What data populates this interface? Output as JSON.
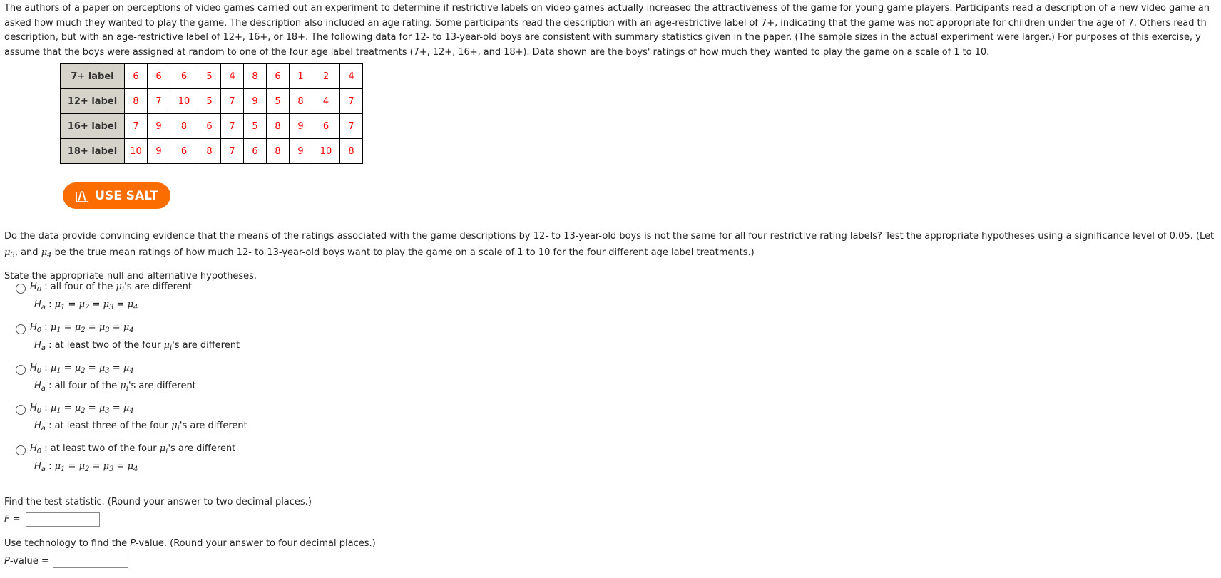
{
  "intro": {
    "lines": [
      "The authors of a paper on perceptions of video games carried out an experiment to determine if restrictive labels on video games actually increased the attractiveness of the game for young game players. Participants read a description of a new video game an",
      "asked how much they wanted to play the game. The description also included an age rating. Some participants read the description with an age-restrictive label of 7+, indicating that the game was not appropriate for children under the age of 7. Others read th",
      "description, but with an age-restrictive label of 12+, 16+, or 18+. The following data for 12- to 13-year-old boys are consistent with summary statistics given in the paper. (The sample sizes in the actual experiment were larger.) For purposes of this exercise, y",
      "assume that the boys were assigned at random to one of the four age label treatments (7+, 12+, 16+, and 18+). Data shown are the boys' ratings of how much they wanted to play the game on a scale of 1 to 10."
    ]
  },
  "table": {
    "rows": [
      {
        "label": "7+ label",
        "values": [
          "6",
          "6",
          "6",
          "5",
          "4",
          "8",
          "6",
          "1",
          "2",
          "4"
        ]
      },
      {
        "label": "12+ label",
        "values": [
          "8",
          "7",
          "10",
          "5",
          "7",
          "9",
          "5",
          "8",
          "4",
          "7"
        ]
      },
      {
        "label": "16+ label",
        "values": [
          "7",
          "9",
          "8",
          "6",
          "7",
          "5",
          "8",
          "9",
          "6",
          "7"
        ]
      },
      {
        "label": "18+ label",
        "values": [
          "10",
          "9",
          "6",
          "8",
          "7",
          "6",
          "8",
          "9",
          "10",
          "8"
        ]
      }
    ]
  },
  "salt_button": {
    "label": "USE SALT",
    "icon": "salt-distribution-icon",
    "color": "#fb6c01"
  },
  "question": {
    "line1": "Do the data provide convincing evidence that the means of the ratings associated with the game descriptions by 12- to 13-year-old boys is not the same for all four restrictive rating labels? Test the appropriate hypotheses using a significance level of 0.05. (Let",
    "line2_prefix": ", and ",
    "line2_suffix": " be the true mean ratings of how much 12- to 13-year-old boys want to play the game on a scale of 1 to 10 for the four different age label treatments.)"
  },
  "hypotheses": {
    "prompt": "State the appropriate null and alternative hypotheses.",
    "options": [
      {
        "h0": ": all four of the μ",
        "h0_tail": "'s are different",
        "ha": ": μ1 = μ2 = μ3 = μ4"
      },
      {
        "h0": ": μ1 = μ2 = μ3 = μ4",
        "ha": ": at least two of the four μ",
        "ha_tail": "'s are different"
      },
      {
        "h0": ": μ1 = μ2 = μ3 = μ4",
        "ha": ": all four of the μ",
        "ha_tail": "'s are different"
      },
      {
        "h0": ": μ1 = μ2 = μ3 = μ4",
        "ha": ": at least three of the four μ",
        "ha_tail": "'s are different"
      },
      {
        "h0": ": at least two of the four μ",
        "h0_tail": "'s are different",
        "ha": ": μ1 = μ2 = μ3 = μ4"
      }
    ]
  },
  "test_statistic": {
    "prompt": "Find the test statistic. (Round your answer to two decimal places.)",
    "label": "F =",
    "value": ""
  },
  "p_value": {
    "prompt_pre": "Use technology to find the ",
    "prompt_italic": "P",
    "prompt_post": "-value. (Round your answer to four decimal places.)",
    "label_italic": "P",
    "label_post": "-value =",
    "value": ""
  }
}
